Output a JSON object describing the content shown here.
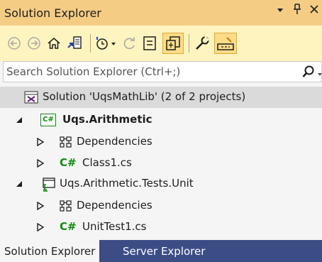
{
  "window": {
    "title": "Solution Explorer"
  },
  "toolbar": {
    "tools": [
      "back-icon",
      "forward-icon",
      "home-icon",
      "switch-views-icon",
      "pending-changes-filter-icon",
      "sync-icon",
      "collapse-all-icon",
      "show-all-files-icon",
      "properties-icon",
      "preview-selected-items-icon"
    ]
  },
  "search": {
    "placeholder": "Search Solution Explorer (Ctrl+;)"
  },
  "tree": {
    "solution": "Solution 'UqsMathLib' (2 of 2 projects)",
    "project1": {
      "name": "Uqs.Arithmetic",
      "dependencies": "Dependencies",
      "file": "Class1.cs"
    },
    "project2": {
      "name": "Uqs.Arithmetic.Tests.Unit",
      "dependencies": "Dependencies",
      "file": "UnitTest1.cs"
    },
    "cs_badge": "C#",
    "cs_icon_text": "C#"
  },
  "bottom_tabs": {
    "solution_explorer": "Solution Explorer",
    "server_explorer": "Server Explorer"
  },
  "colors": {
    "title_bar": "#f5cc84",
    "toolbar": "#fdf4bf",
    "bottom_bar": "#3c4d86",
    "csharp": "#0f8a0f"
  }
}
